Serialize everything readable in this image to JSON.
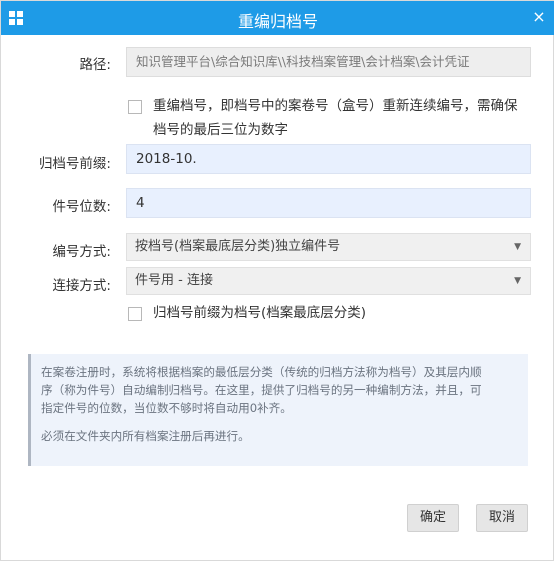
{
  "dialog": {
    "title": "重编归档号",
    "close_glyph": "×"
  },
  "path": {
    "label": "路径:",
    "value": "知识管理平台\\综合知识库\\\\科技档案管理\\会计档案\\会计凭证"
  },
  "renumber": {
    "checked": false,
    "line1": "重编档号，即档号中的案卷号（盒号）重新连续编号，需确保",
    "line2": "档号的最后三位为数字"
  },
  "prefix": {
    "label": "归档号前缀:",
    "value": "2018-10."
  },
  "digits": {
    "label": "件号位数:",
    "value": "4"
  },
  "numbering_mode": {
    "label": "编号方式:",
    "selected": "按档号(档案最底层分类)独立编件号"
  },
  "join_mode": {
    "label": "连接方式:",
    "selected": "件号用 - 连接"
  },
  "prefix_as_archive": {
    "checked": false,
    "label": "归档号前缀为档号(档案最底层分类)"
  },
  "info": {
    "line1": "在案卷注册时，系统将根据档案的最低层分类（传统的归档方法称为档号）及其层内顺",
    "line2": "序（称为件号）自动编制归档号。在这里，提供了归档号的另一种编制方法，并且，可",
    "line3": "指定件号的位数，当位数不够时将自动用0补齐。",
    "line4": "必须在文件夹内所有档案注册后再进行。"
  },
  "buttons": {
    "ok": "确定",
    "cancel": "取消"
  },
  "colors": {
    "titlebar": "#1e9be7",
    "input_bg": "#e8f0fe",
    "info_bg": "#eef3fb"
  },
  "icons": {
    "app": "grid-icon",
    "close": "close-icon",
    "dropdown": "caret-down-icon"
  }
}
